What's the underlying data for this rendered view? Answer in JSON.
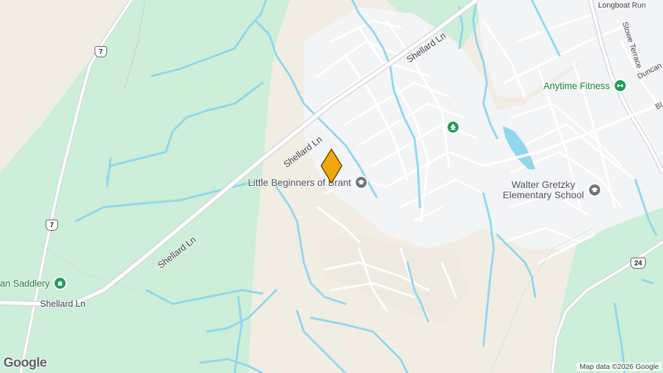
{
  "map": {
    "colors": {
      "park": "#cdeed8",
      "land": "#f1ede3",
      "urban": "#f3f4f6",
      "water": "#8fd8ee",
      "road": "#ffffff",
      "major_road": "#d5d8dc",
      "marker": "#f4a70a"
    },
    "roads": {
      "shellard_1": "Shellard Ln",
      "shellard_2": "Shellard Ln",
      "shellard_3": "Shellard Ln",
      "shellard_4": "Shellard Ln",
      "longboat": "Longboat Run",
      "stowe": "Stowe Terrace",
      "duncan": "Duncan",
      "bl": "Bl"
    },
    "shields": {
      "hwy7_top": "7",
      "hwy7_bottom": "7",
      "hwy24": "24"
    },
    "pois": {
      "anytime": {
        "name": "Anytime Fitness",
        "icon": "fitness-pin-icon"
      },
      "beginners": {
        "name": "Little Beginners of Brant",
        "icon": "school-pin-icon"
      },
      "gretzky_line1": "Walter Gretzky",
      "gretzky_line2": "Elementary School",
      "gretzky_icon": "school-pin-icon",
      "saddlery": {
        "name": "an Saddlery",
        "icon": "shopping-pin-icon"
      },
      "park_icon": "tree-pin-icon"
    },
    "attribution": "Map data ©2026 Google",
    "logo": "Google",
    "marker_icon": "location-marker-icon"
  }
}
